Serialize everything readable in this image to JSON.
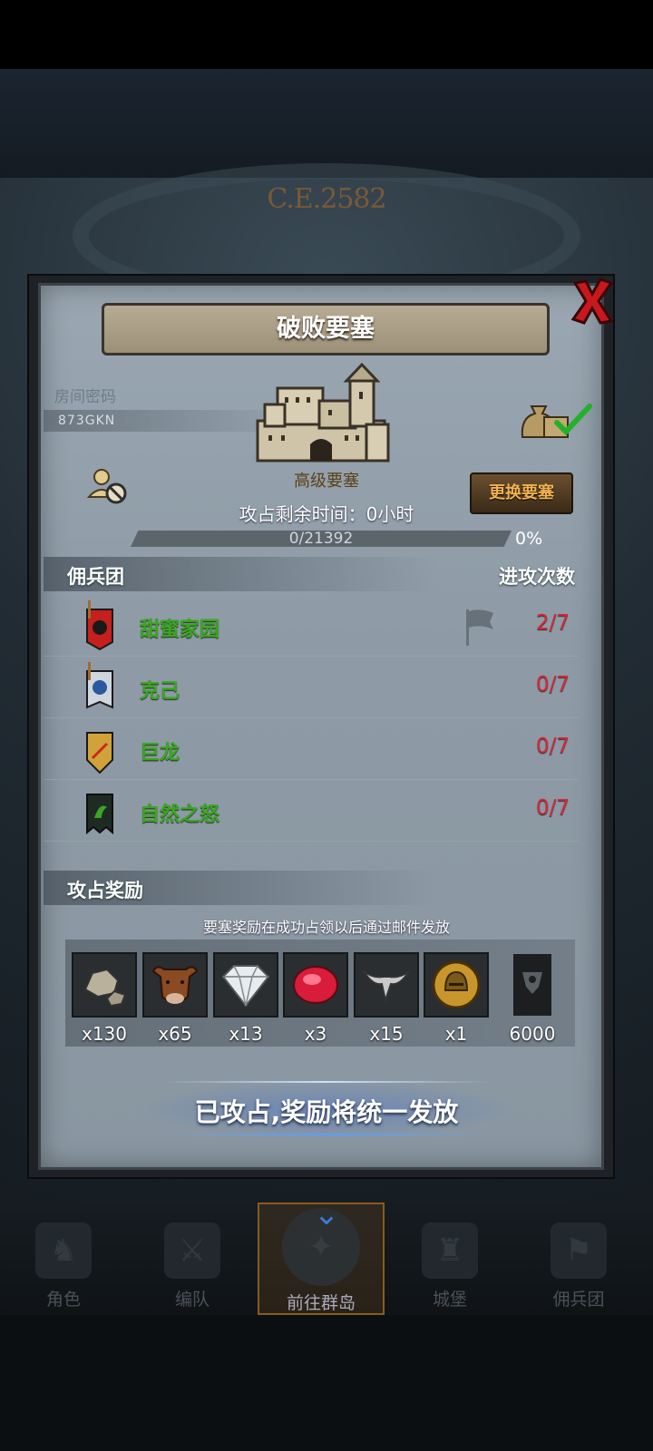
{
  "era_label": "C.E.2582",
  "dialog": {
    "title": "破败要塞",
    "room_password_label": "房间密码",
    "room_password": "873GKN",
    "fortress_type": "高级要塞",
    "change_button": "更换要塞",
    "time_remaining": "攻占剩余时间：0小时",
    "progress_text": "0/21392",
    "progress_percent": "0%",
    "progress_fraction": 0,
    "mercenary_header": "佣兵团",
    "attack_count_header": "进攻次数",
    "mercenaries": [
      {
        "name": "甜蜜家园",
        "count": "2/7",
        "banner_color": "#c6201c",
        "has_flag": true
      },
      {
        "name": "克己",
        "count": "0/7",
        "banner_color": "#cfd6dd",
        "has_flag": false
      },
      {
        "name": "巨龙",
        "count": "0/7",
        "banner_color": "#d2a23a",
        "has_flag": false
      },
      {
        "name": "自然之怒",
        "count": "0/7",
        "banner_color": "#1f2a23",
        "has_flag": false
      }
    ],
    "reward_header": "攻占奖励",
    "reward_note": "要塞奖励在成功占领以后通过邮件发放",
    "rewards": [
      {
        "icon": "stone-icon",
        "qty": "x130"
      },
      {
        "icon": "bull-icon",
        "qty": "x65"
      },
      {
        "icon": "diamond-icon",
        "qty": "x13"
      },
      {
        "icon": "ruby-icon",
        "qty": "x3"
      },
      {
        "icon": "horn-icon",
        "qty": "x15"
      },
      {
        "icon": "helmet-medal-icon",
        "qty": "x1"
      },
      {
        "icon": "banner-icon",
        "qty": "6000"
      }
    ],
    "claim_text": "已攻占,奖励将统一发放"
  },
  "bottom_nav": [
    {
      "label": "角色",
      "icon": "knight-icon",
      "active": false
    },
    {
      "label": "编队",
      "icon": "formation-icon",
      "active": false
    },
    {
      "label": "前往群岛",
      "icon": "compass-icon",
      "active": true
    },
    {
      "label": "城堡",
      "icon": "castle-icon",
      "active": false
    },
    {
      "label": "佣兵团",
      "icon": "mercenary-icon",
      "active": false
    }
  ],
  "colors": {
    "accent_orange": "#f2b250",
    "name_green": "#3ba623",
    "count_red": "#d22a3a",
    "active_tab_border": "#8a5a1e"
  }
}
